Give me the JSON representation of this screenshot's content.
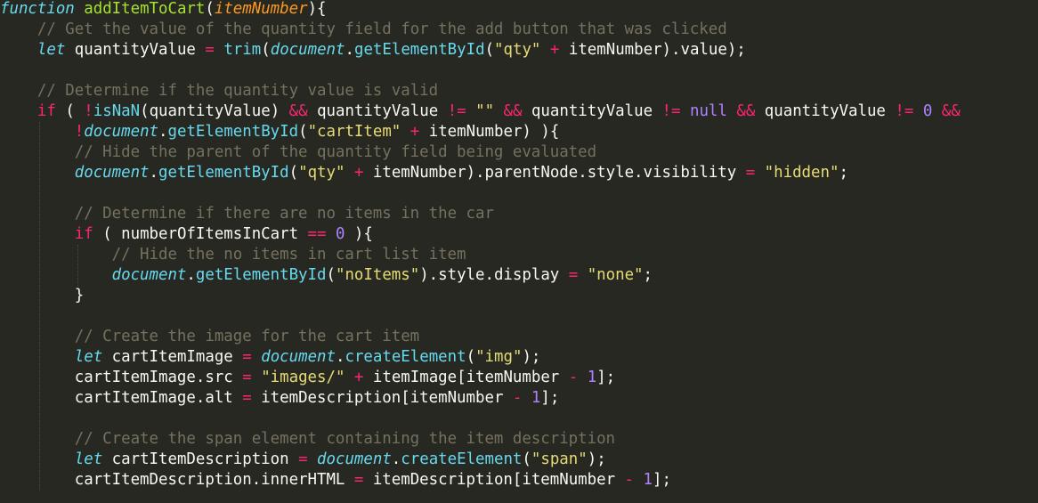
{
  "editor": {
    "theme": "monokai",
    "colors": {
      "background": "#272822",
      "plain": "#f8f8f2",
      "storage": "#66d9ef",
      "keyword": "#f92672",
      "entity": "#a6e22e",
      "param": "#fd971f",
      "comment": "#75715e",
      "string": "#e6db74",
      "number": "#ae81ff"
    },
    "lines": [
      {
        "indent": 0,
        "tokens": [
          {
            "t": "storage",
            "v": "function"
          },
          {
            "t": "plain",
            "v": " "
          },
          {
            "t": "entity",
            "v": "addItemToCart"
          },
          {
            "t": "plain",
            "v": "("
          },
          {
            "t": "param",
            "v": "itemNumber"
          },
          {
            "t": "plain",
            "v": "){"
          }
        ]
      },
      {
        "indent": 1,
        "tokens": [
          {
            "t": "comment",
            "v": "// Get the value of the quantity field for the add button that was clicked"
          }
        ]
      },
      {
        "indent": 1,
        "tokens": [
          {
            "t": "storage",
            "v": "let"
          },
          {
            "t": "plain",
            "v": " quantityValue "
          },
          {
            "t": "operator",
            "v": "="
          },
          {
            "t": "plain",
            "v": " "
          },
          {
            "t": "func",
            "v": "trim"
          },
          {
            "t": "plain",
            "v": "("
          },
          {
            "t": "builtin",
            "v": "document"
          },
          {
            "t": "plain",
            "v": "."
          },
          {
            "t": "func",
            "v": "getElementById"
          },
          {
            "t": "plain",
            "v": "("
          },
          {
            "t": "string",
            "v": "\"qty\""
          },
          {
            "t": "plain",
            "v": " "
          },
          {
            "t": "operator",
            "v": "+"
          },
          {
            "t": "plain",
            "v": " itemNumber).value);"
          }
        ]
      },
      {
        "indent": 1,
        "tokens": []
      },
      {
        "indent": 1,
        "tokens": [
          {
            "t": "comment",
            "v": "// Determine if the quantity value is valid"
          }
        ]
      },
      {
        "indent": 1,
        "tokens": [
          {
            "t": "keyword",
            "v": "if"
          },
          {
            "t": "plain",
            "v": " ( "
          },
          {
            "t": "operator",
            "v": "!"
          },
          {
            "t": "func",
            "v": "isNaN"
          },
          {
            "t": "plain",
            "v": "(quantityValue) "
          },
          {
            "t": "operator",
            "v": "&&"
          },
          {
            "t": "plain",
            "v": " quantityValue "
          },
          {
            "t": "operator",
            "v": "!="
          },
          {
            "t": "plain",
            "v": " "
          },
          {
            "t": "string",
            "v": "\"\""
          },
          {
            "t": "plain",
            "v": " "
          },
          {
            "t": "operator",
            "v": "&&"
          },
          {
            "t": "plain",
            "v": " quantityValue "
          },
          {
            "t": "operator",
            "v": "!="
          },
          {
            "t": "plain",
            "v": " "
          },
          {
            "t": "constant",
            "v": "null"
          },
          {
            "t": "plain",
            "v": " "
          },
          {
            "t": "operator",
            "v": "&&"
          },
          {
            "t": "plain",
            "v": " quantityValue "
          },
          {
            "t": "operator",
            "v": "!="
          },
          {
            "t": "plain",
            "v": " "
          },
          {
            "t": "number",
            "v": "0"
          },
          {
            "t": "plain",
            "v": " "
          },
          {
            "t": "operator",
            "v": "&&"
          }
        ]
      },
      {
        "indent": 2,
        "tokens": [
          {
            "t": "operator",
            "v": "!"
          },
          {
            "t": "builtin",
            "v": "document"
          },
          {
            "t": "plain",
            "v": "."
          },
          {
            "t": "func",
            "v": "getElementById"
          },
          {
            "t": "plain",
            "v": "("
          },
          {
            "t": "string",
            "v": "\"cartItem\""
          },
          {
            "t": "plain",
            "v": " "
          },
          {
            "t": "operator",
            "v": "+"
          },
          {
            "t": "plain",
            "v": " itemNumber) ){"
          }
        ]
      },
      {
        "indent": 2,
        "tokens": [
          {
            "t": "comment",
            "v": "// Hide the parent of the quantity field being evaluated"
          }
        ]
      },
      {
        "indent": 2,
        "tokens": [
          {
            "t": "builtin",
            "v": "document"
          },
          {
            "t": "plain",
            "v": "."
          },
          {
            "t": "func",
            "v": "getElementById"
          },
          {
            "t": "plain",
            "v": "("
          },
          {
            "t": "string",
            "v": "\"qty\""
          },
          {
            "t": "plain",
            "v": " "
          },
          {
            "t": "operator",
            "v": "+"
          },
          {
            "t": "plain",
            "v": " itemNumber).parentNode.style.visibility "
          },
          {
            "t": "operator",
            "v": "="
          },
          {
            "t": "plain",
            "v": " "
          },
          {
            "t": "string",
            "v": "\"hidden\""
          },
          {
            "t": "plain",
            "v": ";"
          }
        ]
      },
      {
        "indent": 2,
        "tokens": []
      },
      {
        "indent": 2,
        "tokens": [
          {
            "t": "comment",
            "v": "// Determine if there are no items in the car"
          }
        ]
      },
      {
        "indent": 2,
        "tokens": [
          {
            "t": "keyword",
            "v": "if"
          },
          {
            "t": "plain",
            "v": " ( numberOfItemsInCart "
          },
          {
            "t": "operator",
            "v": "=="
          },
          {
            "t": "plain",
            "v": " "
          },
          {
            "t": "number",
            "v": "0"
          },
          {
            "t": "plain",
            "v": " ){"
          }
        ]
      },
      {
        "indent": 3,
        "tokens": [
          {
            "t": "comment",
            "v": "// Hide the no items in cart list item"
          }
        ]
      },
      {
        "indent": 3,
        "tokens": [
          {
            "t": "builtin",
            "v": "document"
          },
          {
            "t": "plain",
            "v": "."
          },
          {
            "t": "func",
            "v": "getElementById"
          },
          {
            "t": "plain",
            "v": "("
          },
          {
            "t": "string",
            "v": "\"noItems\""
          },
          {
            "t": "plain",
            "v": ").style.display "
          },
          {
            "t": "operator",
            "v": "="
          },
          {
            "t": "plain",
            "v": " "
          },
          {
            "t": "string",
            "v": "\"none\""
          },
          {
            "t": "plain",
            "v": ";"
          }
        ]
      },
      {
        "indent": 2,
        "tokens": [
          {
            "t": "plain",
            "v": "}"
          }
        ]
      },
      {
        "indent": 2,
        "tokens": []
      },
      {
        "indent": 2,
        "tokens": [
          {
            "t": "comment",
            "v": "// Create the image for the cart item"
          }
        ]
      },
      {
        "indent": 2,
        "tokens": [
          {
            "t": "storage",
            "v": "let"
          },
          {
            "t": "plain",
            "v": " cartItemImage "
          },
          {
            "t": "operator",
            "v": "="
          },
          {
            "t": "plain",
            "v": " "
          },
          {
            "t": "builtin",
            "v": "document"
          },
          {
            "t": "plain",
            "v": "."
          },
          {
            "t": "func",
            "v": "createElement"
          },
          {
            "t": "plain",
            "v": "("
          },
          {
            "t": "string",
            "v": "\"img\""
          },
          {
            "t": "plain",
            "v": ");"
          }
        ]
      },
      {
        "indent": 2,
        "tokens": [
          {
            "t": "plain",
            "v": "cartItemImage.src "
          },
          {
            "t": "operator",
            "v": "="
          },
          {
            "t": "plain",
            "v": " "
          },
          {
            "t": "string",
            "v": "\"images/\""
          },
          {
            "t": "plain",
            "v": " "
          },
          {
            "t": "operator",
            "v": "+"
          },
          {
            "t": "plain",
            "v": " itemImage[itemNumber "
          },
          {
            "t": "operator",
            "v": "-"
          },
          {
            "t": "plain",
            "v": " "
          },
          {
            "t": "number",
            "v": "1"
          },
          {
            "t": "plain",
            "v": "];"
          }
        ]
      },
      {
        "indent": 2,
        "tokens": [
          {
            "t": "plain",
            "v": "cartItemImage.alt "
          },
          {
            "t": "operator",
            "v": "="
          },
          {
            "t": "plain",
            "v": " itemDescription[itemNumber "
          },
          {
            "t": "operator",
            "v": "-"
          },
          {
            "t": "plain",
            "v": " "
          },
          {
            "t": "number",
            "v": "1"
          },
          {
            "t": "plain",
            "v": "];"
          }
        ]
      },
      {
        "indent": 2,
        "tokens": []
      },
      {
        "indent": 2,
        "tokens": [
          {
            "t": "comment",
            "v": "// Create the span element containing the item description"
          }
        ]
      },
      {
        "indent": 2,
        "tokens": [
          {
            "t": "storage",
            "v": "let"
          },
          {
            "t": "plain",
            "v": " cartItemDescription "
          },
          {
            "t": "operator",
            "v": "="
          },
          {
            "t": "plain",
            "v": " "
          },
          {
            "t": "builtin",
            "v": "document"
          },
          {
            "t": "plain",
            "v": "."
          },
          {
            "t": "func",
            "v": "createElement"
          },
          {
            "t": "plain",
            "v": "("
          },
          {
            "t": "string",
            "v": "\"span\""
          },
          {
            "t": "plain",
            "v": ");"
          }
        ]
      },
      {
        "indent": 2,
        "tokens": [
          {
            "t": "plain",
            "v": "cartItemDescription.innerHTML "
          },
          {
            "t": "operator",
            "v": "="
          },
          {
            "t": "plain",
            "v": " itemDescription[itemNumber "
          },
          {
            "t": "operator",
            "v": "-"
          },
          {
            "t": "plain",
            "v": " "
          },
          {
            "t": "number",
            "v": "1"
          },
          {
            "t": "plain",
            "v": "];"
          }
        ]
      }
    ]
  }
}
